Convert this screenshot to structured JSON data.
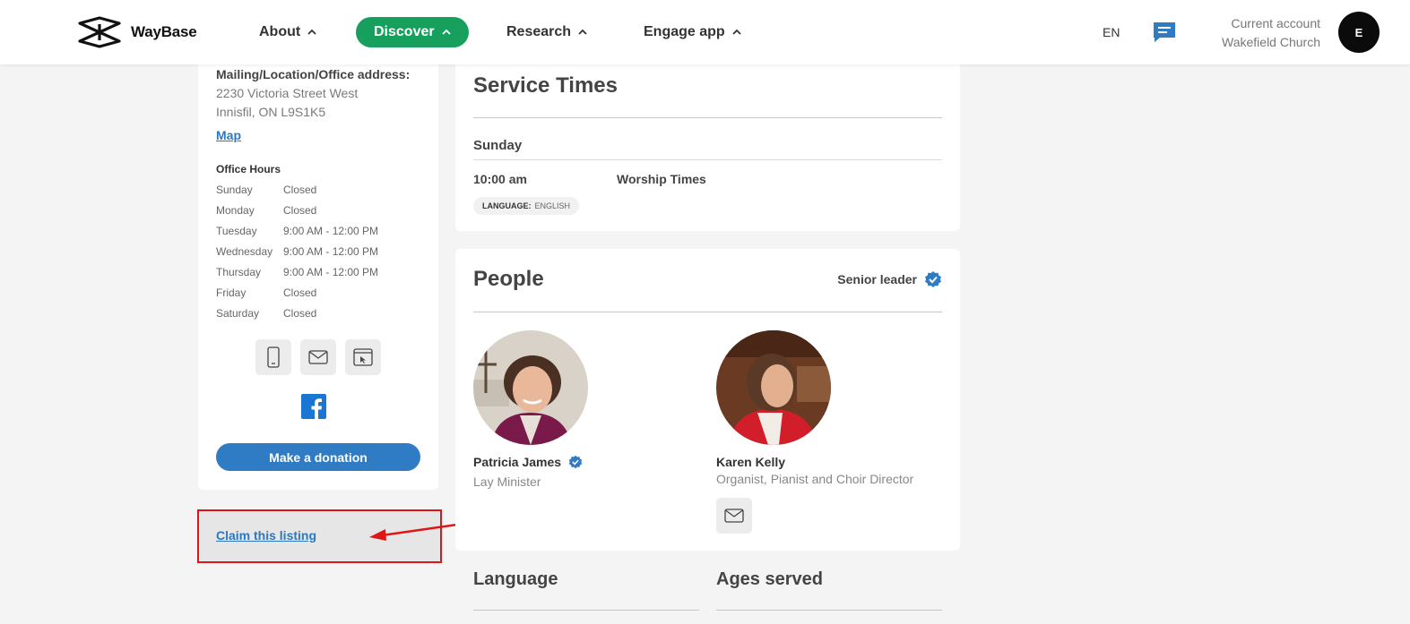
{
  "header": {
    "brand": "WayBase",
    "nav": [
      {
        "label": "About"
      },
      {
        "label": "Discover"
      },
      {
        "label": "Research"
      },
      {
        "label": "Engage app"
      }
    ],
    "language": "EN",
    "account_label": "Current account",
    "account_name": "Wakefield Church",
    "avatar_initial": "E",
    "colors": {
      "discover_pill": "#17a05d",
      "chat_icon": "#2f7bc4"
    }
  },
  "sidebar": {
    "address_label": "Mailing/Location/Office address:",
    "address_line1": "2230 Victoria Street West",
    "address_line2": "Innisfil, ON L9S1K5",
    "map_link": "Map",
    "office_hours_title": "Office Hours",
    "hours": [
      {
        "day": "Sunday",
        "time": "Closed"
      },
      {
        "day": "Monday",
        "time": "Closed"
      },
      {
        "day": "Tuesday",
        "time": "9:00 AM - 12:00 PM"
      },
      {
        "day": "Wednesday",
        "time": "9:00 AM - 12:00 PM"
      },
      {
        "day": "Thursday",
        "time": "9:00 AM - 12:00 PM"
      },
      {
        "day": "Friday",
        "time": "Closed"
      },
      {
        "day": "Saturday",
        "time": "Closed"
      }
    ],
    "contact_icons": [
      "phone-icon",
      "email-icon",
      "website-icon"
    ],
    "social_icon": "facebook-icon",
    "donate_label": "Make a donation",
    "claim_label": "Claim this listing",
    "colors": {
      "link": "#2b78c2",
      "donate": "#2f7bc4",
      "highlight_box": "#e01515"
    }
  },
  "service_times": {
    "title": "Service Times",
    "day": "Sunday",
    "time": "10:00 am",
    "name": "Worship Times",
    "lang_key": "LANGUAGE:",
    "lang_value": "ENGLISH"
  },
  "people": {
    "title": "People",
    "senior_label": "Senior leader",
    "persons": [
      {
        "name": "Patricia James",
        "role": "Lay Minister",
        "verified": true
      },
      {
        "name": "Karen Kelly",
        "role": "Organist, Pianist and Choir Director",
        "verified": false
      }
    ]
  },
  "sections": {
    "language_title": "Language",
    "ages_title": "Ages served"
  }
}
